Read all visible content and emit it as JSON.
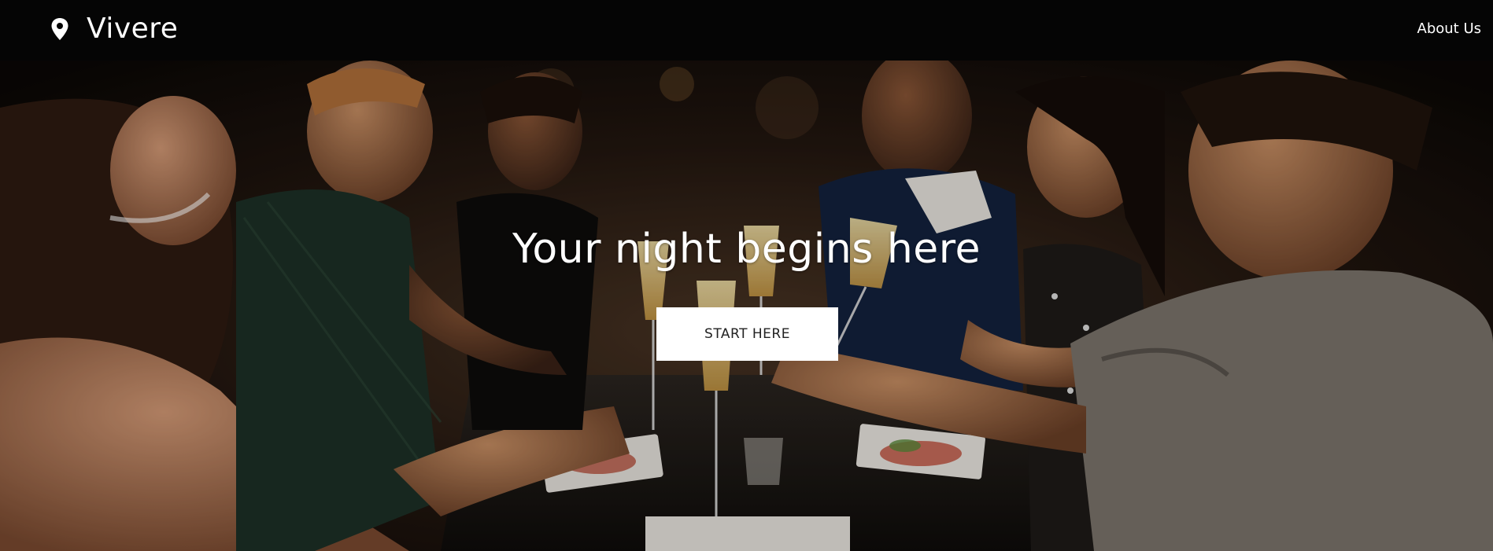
{
  "brand": {
    "name": "Vivere",
    "icon": "map-pin-icon"
  },
  "nav": {
    "about_label": "About Us"
  },
  "hero": {
    "title": "Your night begins here",
    "cta_label": "START HERE",
    "background_image": "friends-toasting-at-dinner-photo"
  },
  "colors": {
    "navbar_bg": "#050505",
    "text": "#ffffff",
    "cta_bg": "#ffffff",
    "cta_text": "#222222"
  }
}
